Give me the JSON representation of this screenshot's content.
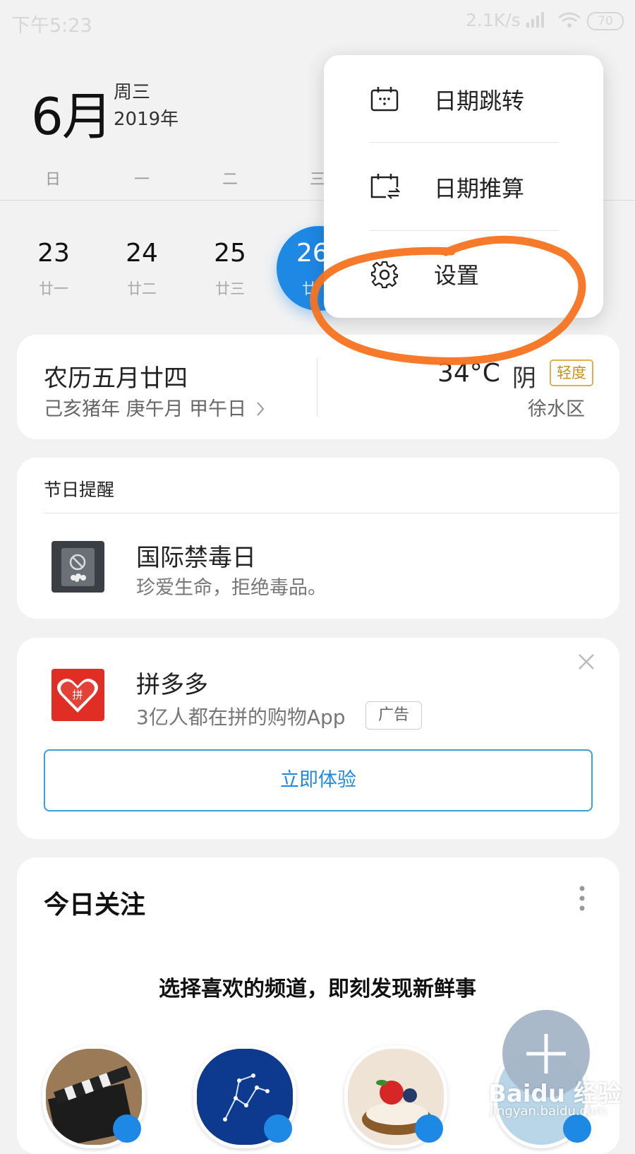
{
  "status_bar": {
    "time": "下午5:23",
    "net_speed": "2.1K/s",
    "battery": "70"
  },
  "header": {
    "month": "6月",
    "weekday": "周三",
    "year": "2019年"
  },
  "week_headers": [
    "日",
    "一",
    "二",
    "三"
  ],
  "days": [
    {
      "num": "23",
      "lunar": "廿一"
    },
    {
      "num": "24",
      "lunar": "廿二"
    },
    {
      "num": "25",
      "lunar": "廿三"
    },
    {
      "num": "26",
      "lunar": "廿"
    }
  ],
  "lunar_card": {
    "title": "农历五月廿四",
    "ganzhi": "己亥猪年 庚午月 甲午日",
    "temperature": "34°C",
    "weather": "阴",
    "air_quality": "轻度",
    "district": "徐水区"
  },
  "holiday_card": {
    "heading": "节日提醒",
    "name": "国际禁毒日",
    "slogan": "珍爱生命，拒绝毒品。"
  },
  "ad_card": {
    "name": "拼多多",
    "description": "3亿人都在拼的购物App",
    "tag": "广告",
    "cta": "立即体验",
    "logo_text": "拼"
  },
  "focus_card": {
    "title": "今日关注",
    "prompt": "选择喜欢的频道，即刻发现新鲜事"
  },
  "menu": {
    "items": [
      {
        "label": "日期跳转",
        "icon": "calendar-icon"
      },
      {
        "label": "日期推算",
        "icon": "calendar-swap-icon"
      },
      {
        "label": "设置",
        "icon": "gear-icon"
      }
    ]
  },
  "watermark": {
    "brand": "Baidu 经验",
    "url": "jingyan.baidu.com"
  },
  "colors": {
    "accent": "#1e88e5",
    "annotation": "#f5731f",
    "pdd_red": "#e02e24",
    "aqi_gold": "#c99020"
  }
}
